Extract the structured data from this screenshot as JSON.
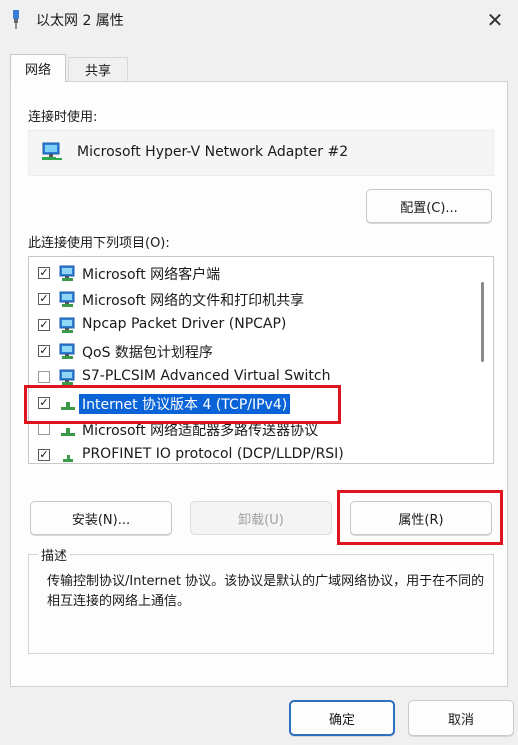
{
  "window": {
    "title": "以太网 2 属性",
    "close_glyph": "✕"
  },
  "tabs": [
    {
      "label": "网络"
    },
    {
      "label": "共享"
    }
  ],
  "connect_using_label": "连接时使用:",
  "adapter": {
    "name": "Microsoft Hyper-V Network Adapter #2",
    "icon": "network-adapter-icon"
  },
  "configure_button": "配置(C)...",
  "items_label": "此连接使用下列项目(O):",
  "items": [
    {
      "label": "Microsoft 网络客户端",
      "checked": true,
      "icon": "network-client-icon"
    },
    {
      "label": "Microsoft 网络的文件和打印机共享",
      "checked": true,
      "icon": "network-service-icon"
    },
    {
      "label": "Npcap Packet Driver (NPCAP)",
      "checked": true,
      "icon": "network-service-icon"
    },
    {
      "label": "QoS 数据包计划程序",
      "checked": true,
      "icon": "network-service-icon"
    },
    {
      "label": "S7-PLCSIM Advanced Virtual Switch",
      "checked": false,
      "icon": "network-service-icon"
    },
    {
      "label": "Internet 协议版本 4 (TCP/IPv4)",
      "checked": true,
      "icon": "protocol-icon",
      "selected": true
    },
    {
      "label": "Microsoft 网络适配器多路传送器协议",
      "checked": false,
      "icon": "protocol-icon"
    },
    {
      "label": "PROFINET IO protocol (DCP/LLDP/RSI)",
      "checked": true,
      "icon": "protocol-icon"
    }
  ],
  "install_button": "安装(N)...",
  "uninstall_button": "卸载(U)",
  "properties_button": "属性(R)",
  "description": {
    "title": "描述",
    "text": "传输控制协议/Internet 协议。该协议是默认的广域网络协议，用于在不同的相互连接的网络上通信。"
  },
  "ok_button": "确定",
  "cancel_button": "取消",
  "colors": {
    "selection": "#0a64d8",
    "highlight": "#e0141e",
    "primary_border": "#2f6fc0"
  }
}
